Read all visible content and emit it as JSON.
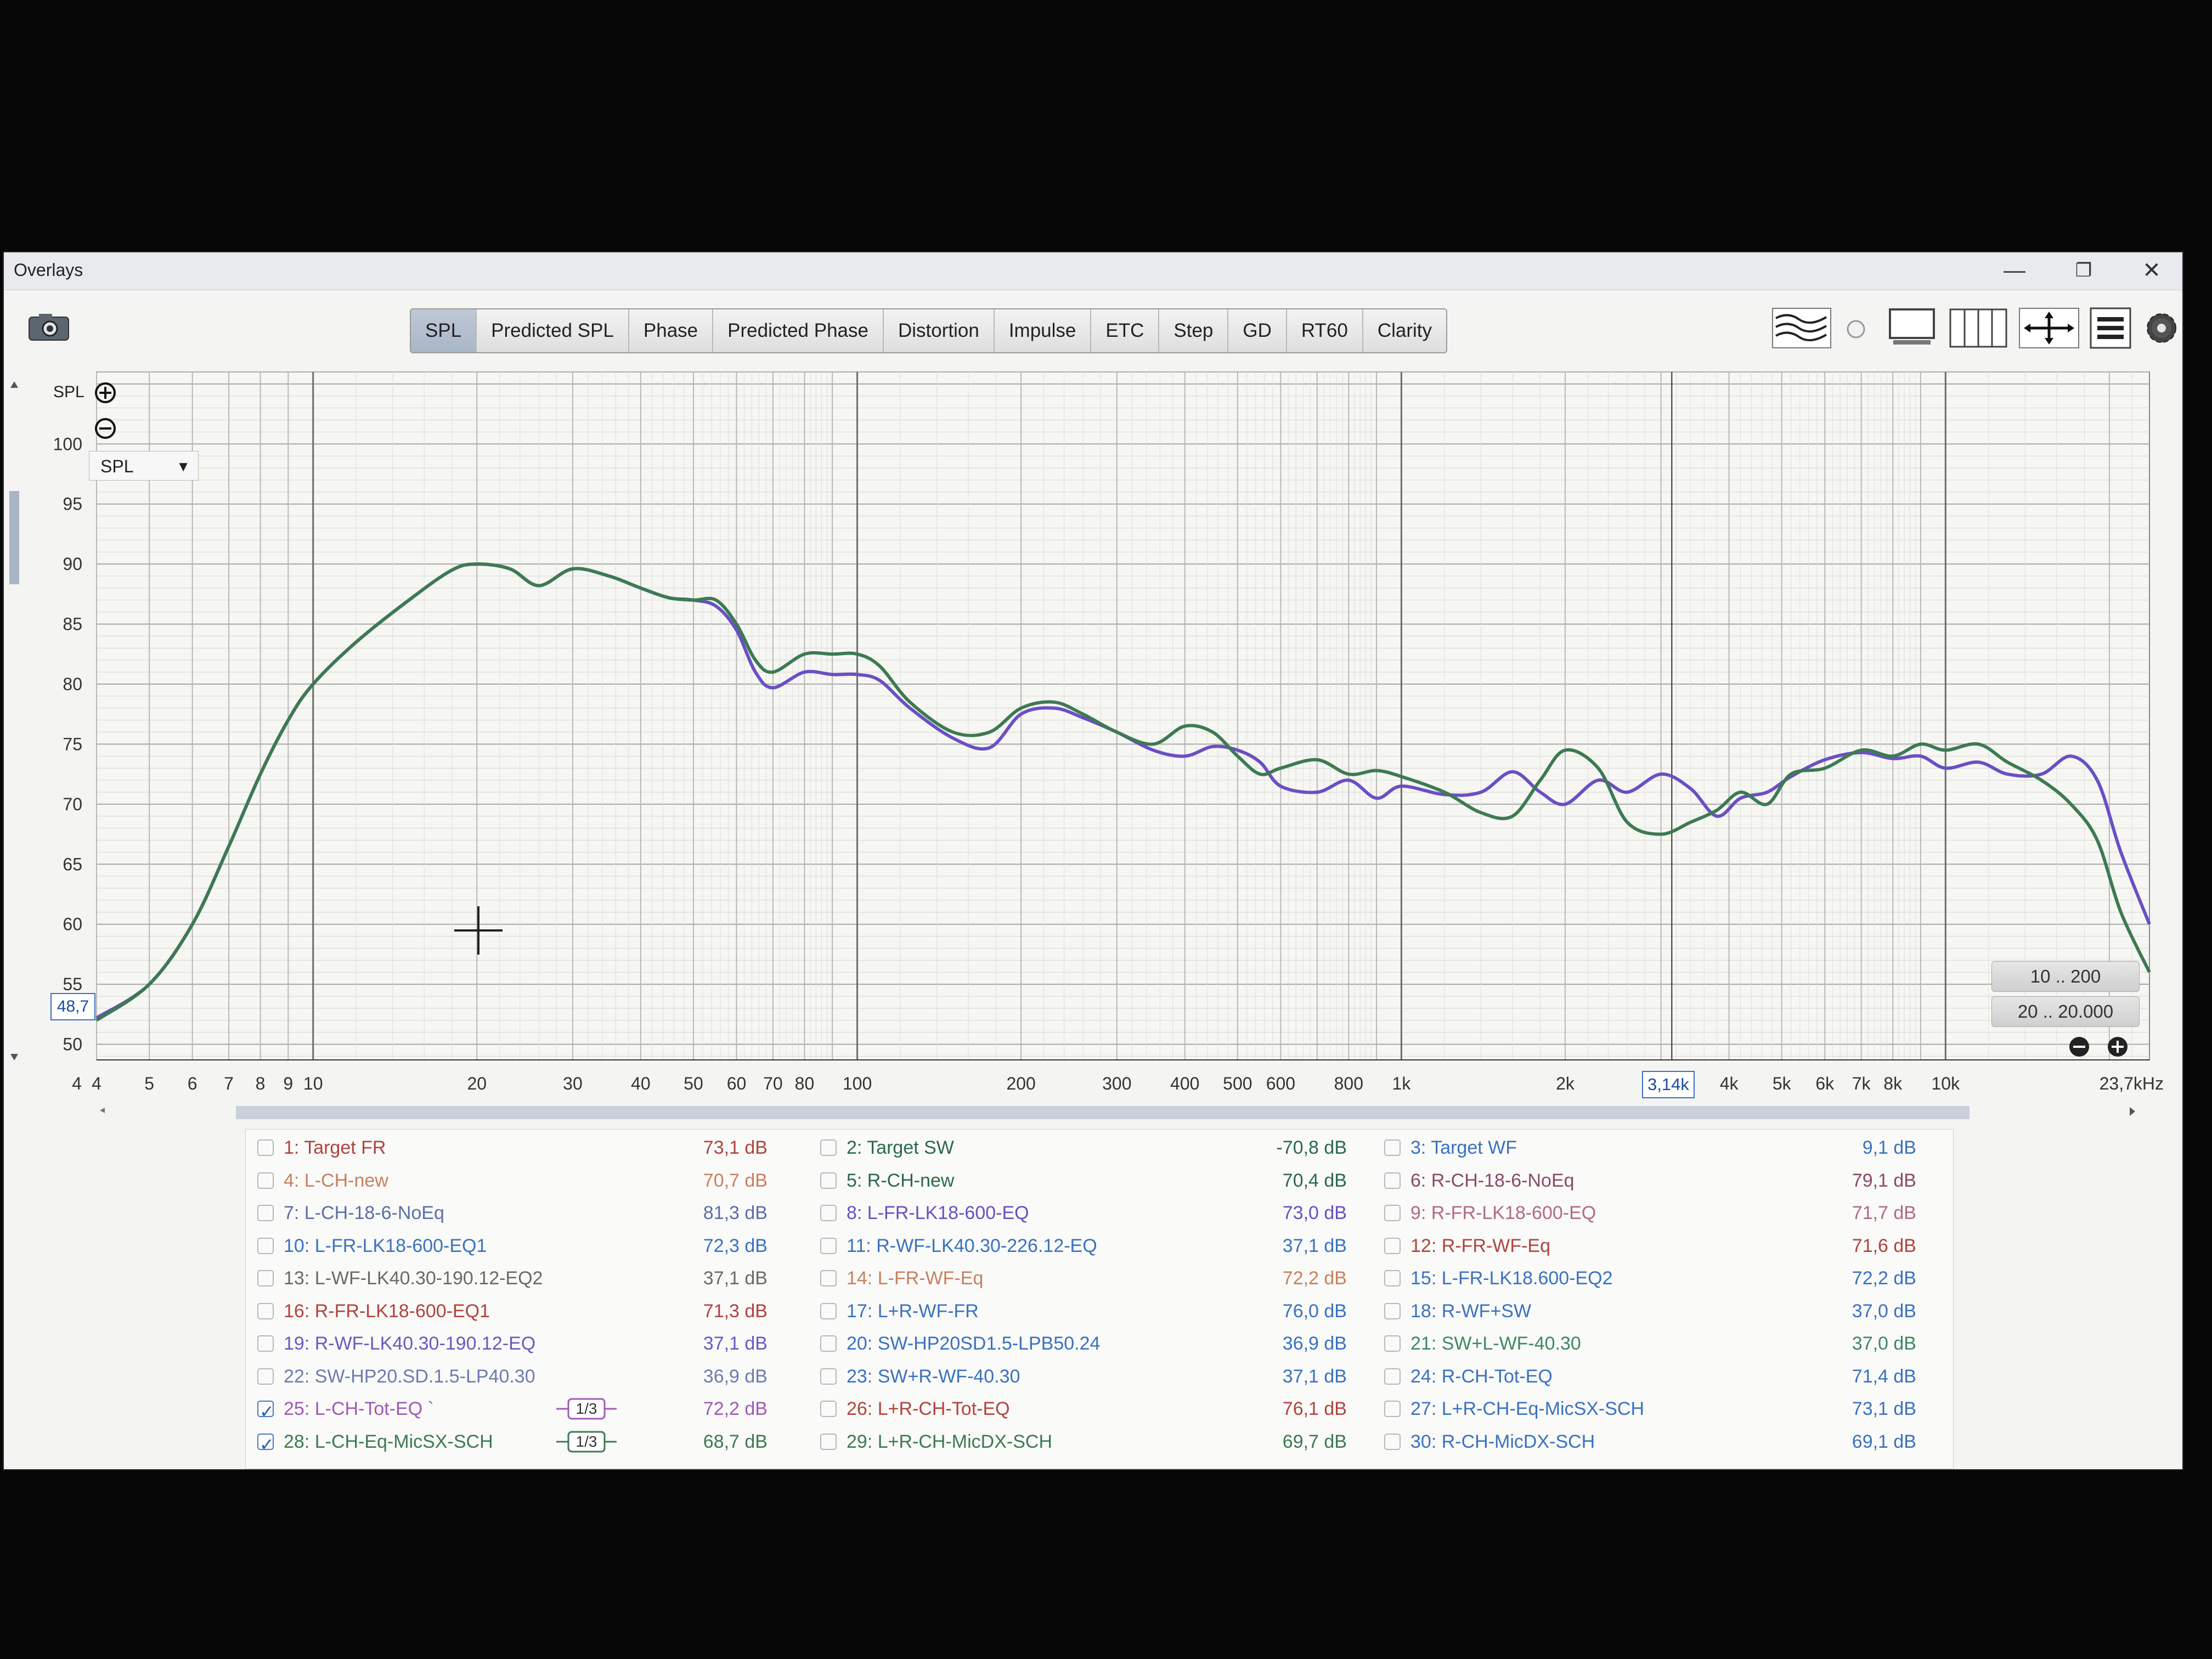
{
  "window": {
    "title": "Overlays",
    "minimize_label": "—",
    "restore_label": "❐",
    "close_label": "✕"
  },
  "toolbar": {
    "tabs": [
      "SPL",
      "Predicted SPL",
      "Phase",
      "Predicted Phase",
      "Distortion",
      "Impulse",
      "ETC",
      "Step",
      "GD",
      "RT60",
      "Clarity"
    ],
    "active_tab": "SPL",
    "side_label": "SPL"
  },
  "plot": {
    "y_selector": "SPL",
    "cursor_y_value": "48,7",
    "cursor_x_value": "3,14k",
    "range_buttons": [
      "10 .. 200",
      "20 .. 20.000"
    ],
    "zoom_in_icon": "zoom-in-icon",
    "zoom_out_icon": "zoom-out-icon"
  },
  "chart_data": {
    "type": "line",
    "title": "",
    "xlabel": "",
    "ylabel": "SPL",
    "x_scale": "log",
    "xlim": [
      4,
      23700
    ],
    "ylim": [
      48.7,
      106
    ],
    "x_tick_labels": [
      "4",
      "4",
      "5",
      "6",
      "7",
      "8",
      "9",
      "10",
      "20",
      "30",
      "40",
      "50",
      "60",
      "70",
      "80",
      "100",
      "200",
      "300",
      "400",
      "500",
      "600",
      "800",
      "1k",
      "2k",
      "3,14k",
      "4k",
      "5k",
      "6k",
      "7k",
      "8k",
      "10k",
      "23,7kHz"
    ],
    "y_tick_labels": [
      "50",
      "55",
      "60",
      "65",
      "70",
      "75",
      "80",
      "85",
      "90",
      "95",
      "100"
    ],
    "grid": true,
    "series": [
      {
        "name": "25: L-CH-Tot-EQ",
        "color": "#6a4fc4",
        "x": [
          4,
          5,
          6,
          7,
          8,
          9,
          10,
          12,
          15,
          18,
          20,
          23,
          26,
          30,
          35,
          40,
          45,
          50,
          55,
          60,
          65,
          70,
          80,
          90,
          100,
          110,
          125,
          150,
          175,
          200,
          230,
          260,
          300,
          350,
          400,
          450,
          500,
          550,
          600,
          700,
          800,
          900,
          1000,
          1200,
          1400,
          1600,
          1800,
          2000,
          2300,
          2600,
          3000,
          3400,
          3800,
          4200,
          4700,
          5200,
          6000,
          7000,
          8000,
          9000,
          10000,
          11500,
          13000,
          15000,
          17000,
          19000,
          21000,
          23700
        ],
        "y": [
          52.2,
          55.0,
          60.0,
          66.5,
          72.5,
          77.0,
          80.0,
          83.5,
          87.0,
          89.5,
          90.0,
          89.6,
          88.2,
          89.6,
          89.0,
          88.0,
          87.2,
          87.0,
          86.5,
          84.5,
          81.0,
          79.7,
          81.0,
          80.8,
          80.8,
          80.3,
          78.0,
          75.5,
          74.7,
          77.5,
          78.0,
          77.2,
          76.0,
          74.5,
          74.0,
          74.8,
          74.5,
          73.5,
          71.5,
          71.0,
          72.0,
          70.5,
          71.5,
          70.8,
          71.0,
          72.7,
          71.0,
          70.0,
          72.0,
          71.0,
          72.5,
          71.3,
          69.0,
          70.5,
          71.0,
          72.3,
          73.7,
          74.3,
          73.8,
          74.0,
          73.0,
          73.5,
          72.5,
          72.5,
          74.0,
          72.0,
          66.0,
          60.0
        ]
      },
      {
        "name": "28: L-CH-Eq-MicSX-SCH",
        "color": "#3d7a52",
        "x": [
          4,
          5,
          6,
          7,
          8,
          9,
          10,
          12,
          15,
          18,
          20,
          23,
          26,
          30,
          35,
          40,
          45,
          50,
          55,
          60,
          65,
          70,
          80,
          90,
          100,
          110,
          125,
          150,
          175,
          200,
          230,
          260,
          300,
          350,
          400,
          450,
          500,
          550,
          600,
          700,
          800,
          900,
          1000,
          1200,
          1400,
          1600,
          1800,
          2000,
          2300,
          2600,
          3000,
          3400,
          3800,
          4200,
          4700,
          5200,
          6000,
          7000,
          8000,
          9000,
          10000,
          11500,
          13000,
          15000,
          17000,
          19000,
          21000,
          23700
        ],
        "y": [
          52.0,
          55.0,
          60.0,
          66.5,
          72.5,
          77.0,
          80.0,
          83.5,
          87.0,
          89.5,
          90.0,
          89.6,
          88.2,
          89.6,
          89.0,
          88.0,
          87.2,
          87.0,
          87.0,
          85.0,
          82.0,
          81.0,
          82.5,
          82.5,
          82.5,
          81.5,
          78.5,
          76.0,
          76.0,
          78.0,
          78.5,
          77.5,
          76.0,
          75.0,
          76.5,
          76.0,
          74.0,
          72.5,
          73.0,
          73.7,
          72.5,
          72.8,
          72.3,
          71.0,
          69.3,
          69.0,
          72.0,
          74.5,
          73.0,
          68.5,
          67.5,
          68.5,
          69.5,
          71.0,
          70.0,
          72.5,
          73.0,
          74.5,
          74.0,
          75.0,
          74.5,
          75.0,
          73.5,
          72.0,
          70.0,
          67.0,
          61.0,
          56.0
        ]
      }
    ]
  },
  "legend": {
    "columns": [
      [
        {
          "label": "1: Target FR",
          "value": "73,1 dB",
          "color": "#b0443f",
          "checked": false
        },
        {
          "label": "4: L-CH-new",
          "value": "70,7 dB",
          "color": "#c88060",
          "checked": false
        },
        {
          "label": "7: L-CH-18-6-NoEq",
          "value": "81,3 dB",
          "color": "#5b6fa8",
          "checked": false
        },
        {
          "label": "10: L-FR-LK18-600-EQ1",
          "value": "72,3 dB",
          "color": "#3a72c0",
          "checked": false
        },
        {
          "label": "13: L-WF-LK40.30-190.12-EQ2",
          "value": "37,1 dB",
          "color": "#6a6a6a",
          "checked": false
        },
        {
          "label": "16: R-FR-LK18-600-EQ1",
          "value": "71,3 dB",
          "color": "#b0443f",
          "checked": false
        },
        {
          "label": "19: R-WF-LK40.30-190.12-EQ",
          "value": "37,1 dB",
          "color": "#6b5ac0",
          "checked": false
        },
        {
          "label": "22: SW-HP20.SD.1.5-LP40.30",
          "value": "36,9 dB",
          "color": "#6b7db0",
          "checked": false
        },
        {
          "label": "25: L-CH-Tot-EQ `",
          "value": "72,2 dB",
          "color": "#a05ab8",
          "checked": true,
          "smoothing": "1/3"
        },
        {
          "label": "28: L-CH-Eq-MicSX-SCH",
          "value": "68,7 dB",
          "color": "#3d7a52",
          "checked": true,
          "smoothing": "1/3"
        }
      ],
      [
        {
          "label": "2: Target SW",
          "value": "-70,8 dB",
          "color": "#2b6a4a",
          "checked": false
        },
        {
          "label": "5: R-CH-new",
          "value": "70,4 dB",
          "color": "#2b6a4a",
          "checked": false
        },
        {
          "label": "8: L-FR-LK18-600-EQ",
          "value": "73,0 dB",
          "color": "#6a4fc4",
          "checked": false
        },
        {
          "label": "11: R-WF-LK40.30-226.12-EQ",
          "value": "37,1 dB",
          "color": "#3a72c0",
          "checked": false
        },
        {
          "label": "14: L-FR-WF-Eq",
          "value": "72,2 dB",
          "color": "#c88060",
          "checked": false
        },
        {
          "label": "17: L+R-WF-FR",
          "value": "76,0 dB",
          "color": "#3a72c0",
          "checked": false
        },
        {
          "label": "20: SW-HP20SD1.5-LPB50.24",
          "value": "36,9 dB",
          "color": "#3a72c0",
          "checked": false
        },
        {
          "label": "23: SW+R-WF-40.30",
          "value": "37,1 dB",
          "color": "#3a72c0",
          "checked": false
        },
        {
          "label": "26: L+R-CH-Tot-EQ",
          "value": "76,1 dB",
          "color": "#b0443f",
          "checked": false
        },
        {
          "label": "29: L+R-CH-MicDX-SCH",
          "value": "69,7 dB",
          "color": "#3d7a52",
          "checked": false
        }
      ],
      [
        {
          "label": "3: Target WF",
          "value": "9,1 dB",
          "color": "#3a72c0",
          "checked": false
        },
        {
          "label": "6: R-CH-18-6-NoEq",
          "value": "79,1 dB",
          "color": "#8a4a6a",
          "checked": false
        },
        {
          "label": "9: R-FR-LK18-600-EQ",
          "value": "71,7 dB",
          "color": "#b06a8a",
          "checked": false
        },
        {
          "label": "12: R-FR-WF-Eq",
          "value": "71,6 dB",
          "color": "#b0443f",
          "checked": false
        },
        {
          "label": "15: L-FR-LK18.600-EQ2",
          "value": "72,2 dB",
          "color": "#3a72c0",
          "checked": false
        },
        {
          "label": "18: R-WF+SW",
          "value": "37,0 dB",
          "color": "#3a72c0",
          "checked": false
        },
        {
          "label": "21: SW+L-WF-40.30",
          "value": "37,0 dB",
          "color": "#3d8a62",
          "checked": false
        },
        {
          "label": "24: R-CH-Tot-EQ",
          "value": "71,4 dB",
          "color": "#3a72c0",
          "checked": false
        },
        {
          "label": "27: L+R-CH-Eq-MicSX-SCH",
          "value": "73,1 dB",
          "color": "#3a72c0",
          "checked": false
        },
        {
          "label": "30: R-CH-MicDX-SCH",
          "value": "69,1 dB",
          "color": "#3a72c0",
          "checked": false
        }
      ]
    ]
  }
}
